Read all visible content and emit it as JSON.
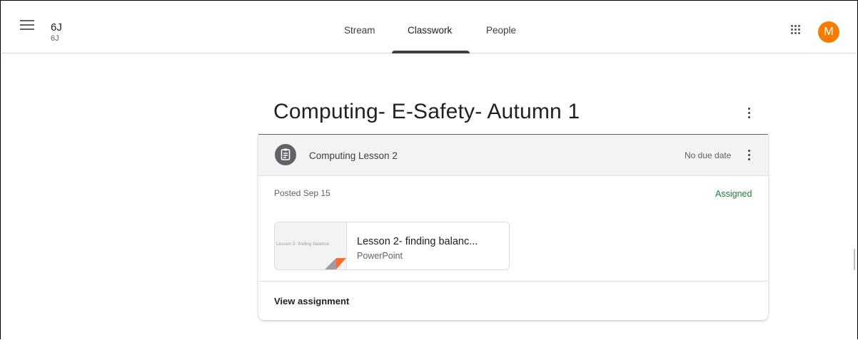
{
  "header": {
    "class_name": "6J",
    "class_section": "6J",
    "menu_icon": "hamburger-menu-icon",
    "apps_icon": "google-apps-icon",
    "avatar_initial": "M",
    "avatar_color": "#f57c00"
  },
  "tabs": [
    {
      "label": "Stream",
      "active": false
    },
    {
      "label": "Classwork",
      "active": true
    },
    {
      "label": "People",
      "active": false
    }
  ],
  "topic": {
    "title": "Computing- E-Safety- Autumn 1"
  },
  "assignment": {
    "icon": "assignment-icon",
    "title": "Computing Lesson 2",
    "due": "No due date",
    "posted": "Posted Sep 15",
    "status": "Assigned",
    "status_color": "#188038",
    "attachment": {
      "thumbnail_text": "Lesson 2- finding balance",
      "title": "Lesson 2- finding balanc...",
      "type": "PowerPoint",
      "badge_color": "#ff6d2c"
    },
    "view_label": "View assignment"
  }
}
